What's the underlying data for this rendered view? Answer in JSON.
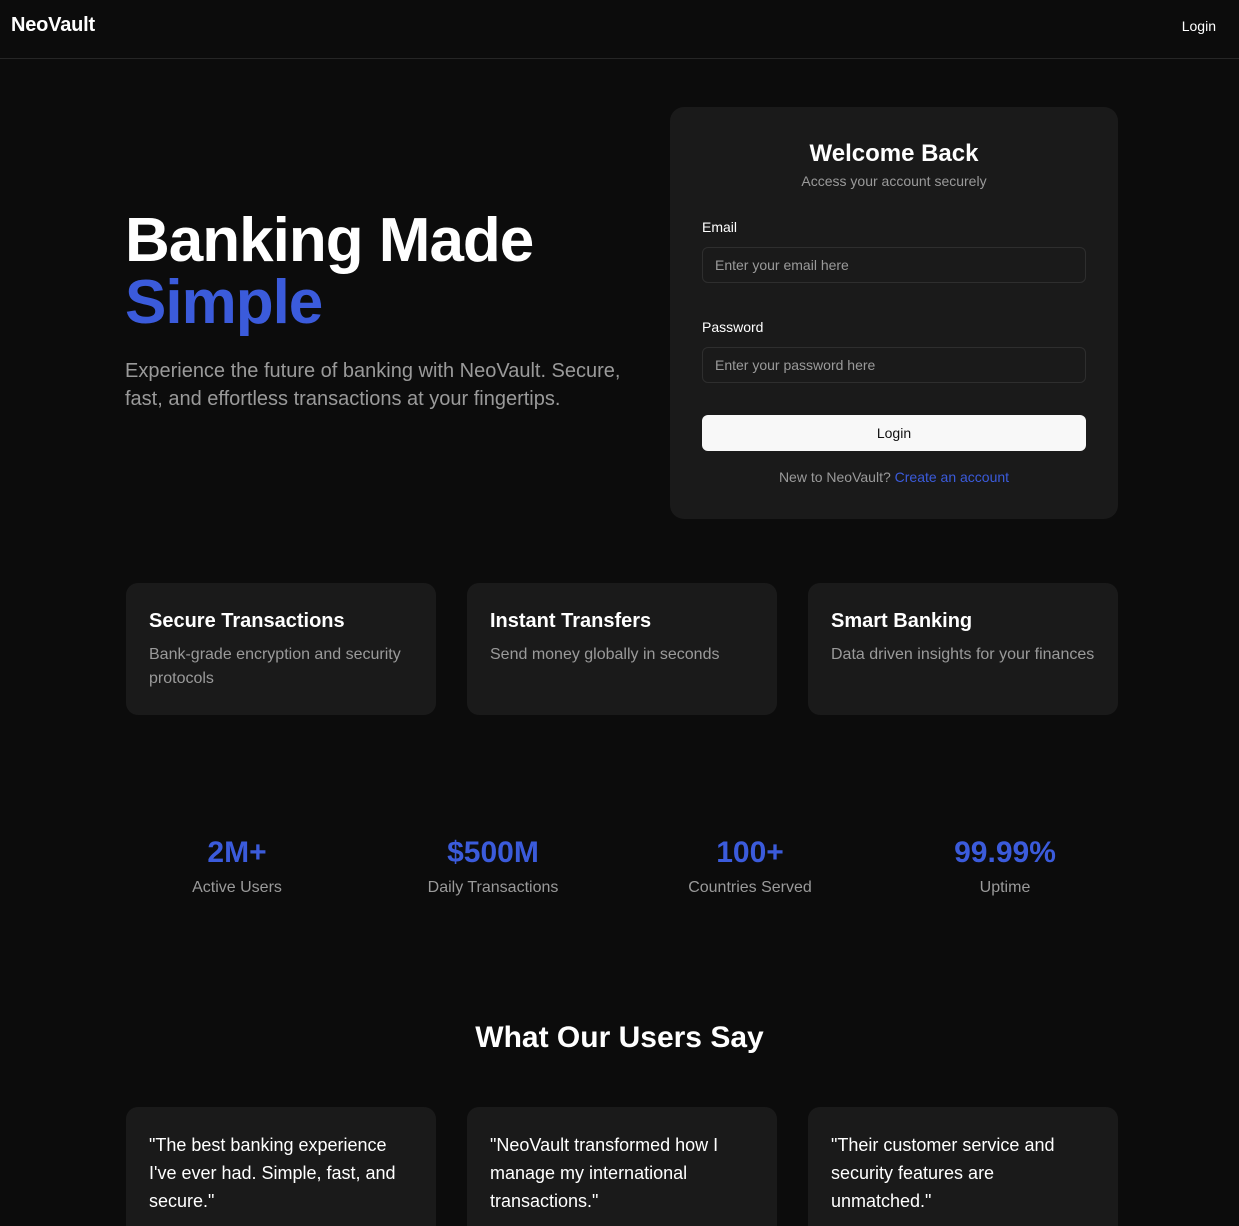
{
  "nav": {
    "brand": "NeoVault",
    "login_label": "Login"
  },
  "hero": {
    "title_line1": "Banking Made",
    "title_line2": "Simple",
    "subtitle": "Experience the future of banking with NeoVault. Secure, fast, and effortless transactions at your fingertips."
  },
  "login_card": {
    "title": "Welcome Back",
    "subtitle": "Access your account securely",
    "email_label": "Email",
    "email_placeholder": "Enter your email here",
    "email_value": "",
    "password_label": "Password",
    "password_placeholder": "Enter your password here",
    "password_value": "",
    "submit_label": "Login",
    "signup_prompt": "New to NeoVault?",
    "signup_link": "Create an account"
  },
  "features": [
    {
      "title": "Secure Transactions",
      "description": "Bank-grade encryption and security protocols"
    },
    {
      "title": "Instant Transfers",
      "description": "Send money globally in seconds"
    },
    {
      "title": "Smart Banking",
      "description": "Data driven insights for your finances"
    }
  ],
  "stats": [
    {
      "value": "2M+",
      "label": "Active Users"
    },
    {
      "value": "$500M",
      "label": "Daily Transactions"
    },
    {
      "value": "100+",
      "label": "Countries Served"
    },
    {
      "value": "99.99%",
      "label": "Uptime"
    }
  ],
  "testimonials": {
    "title": "What Our Users Say",
    "quotes": [
      "\"The best banking experience I've ever had. Simple, fast, and secure.\"",
      "\"NeoVault transformed how I manage my international transactions.\"",
      "\"Their customer service and security features are unmatched.\""
    ]
  },
  "colors": {
    "background": "#0c0c0c",
    "card": "#1a1a1a",
    "accent": "#3b5bdb",
    "muted_text": "#9a9a9a"
  }
}
